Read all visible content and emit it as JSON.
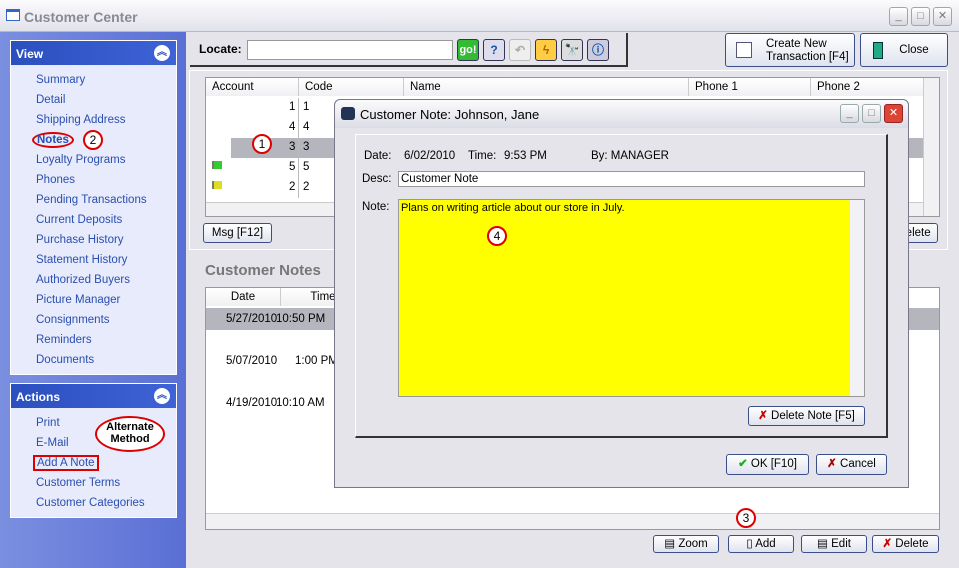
{
  "window": {
    "title": "Customer Center"
  },
  "sidebar": {
    "view": {
      "title": "View",
      "items": [
        "Summary",
        "Detail",
        "Shipping Address",
        "Notes",
        "Loyalty Programs",
        "Phones",
        "Pending Transactions",
        "Current Deposits",
        "Purchase History",
        "Statement History",
        "Authorized Buyers",
        "Picture Manager",
        "Consignments",
        "Reminders",
        "Documents"
      ],
      "selected": "Notes"
    },
    "actions": {
      "title": "Actions",
      "items": [
        "Print",
        "E-Mail",
        "Add A Note",
        "Customer Terms",
        "Customer Categories"
      ]
    }
  },
  "callouts": {
    "c1": "1",
    "c2": "2",
    "c3": "3",
    "c4": "4",
    "alternate": "Alternate Method"
  },
  "toolbar": {
    "locate_label": "Locate:",
    "locate_value": "",
    "go": "go!",
    "create_new": "Create New",
    "create_new2": "Transaction [F4]",
    "close": "Close"
  },
  "customers": {
    "columns": [
      "Account",
      "Code",
      "Name",
      "Phone 1",
      "Phone 2"
    ],
    "rows": [
      {
        "account": "1",
        "code": "1",
        "flag": ""
      },
      {
        "account": "4",
        "code": "4",
        "flag": ""
      },
      {
        "account": "3",
        "code": "3",
        "flag": "",
        "selected": true
      },
      {
        "account": "5",
        "code": "5",
        "flag": "green"
      },
      {
        "account": "2",
        "code": "2",
        "flag": "yellow"
      }
    ],
    "msg_button": "Msg [F12]",
    "delete_button": "Delete"
  },
  "notes": {
    "title": "Customer Notes",
    "columns": [
      "Date",
      "Time"
    ],
    "rows": [
      {
        "date": "5/27/2010",
        "time": "10:50 PM"
      },
      {
        "date": "5/07/2010",
        "time": "1:00 PM"
      },
      {
        "date": "4/19/2010",
        "time": "10:10 AM"
      }
    ],
    "buttons": {
      "zoom": "Zoom",
      "add": "Add",
      "edit": "Edit",
      "delete": "Delete"
    }
  },
  "dialog": {
    "title": "Customer Note: Johnson, Jane",
    "date_label": "Date:",
    "date": "6/02/2010",
    "time_label": "Time:",
    "time": "9:53 PM",
    "by": "By: MANAGER",
    "desc_label": "Desc:",
    "desc": "Customer Note",
    "note_label": "Note:",
    "note": "Plans on writing article about our store in July.",
    "note_color": "#ffff00",
    "delete_note": "Delete Note [F5]",
    "ok": "OK [F10]",
    "cancel": "Cancel"
  }
}
